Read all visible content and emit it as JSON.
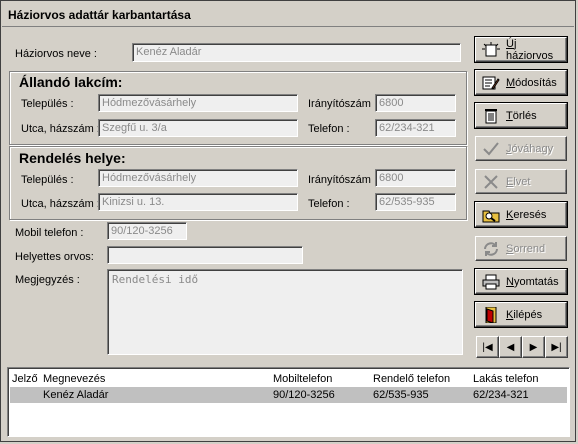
{
  "window": {
    "title": "Háziorvos adattár karbantartása"
  },
  "doctor": {
    "label": "Háziorvos neve :",
    "value": "Kenéz Aladár"
  },
  "permanent_address": {
    "title": "Állandó lakcím:",
    "city_label": "Település :",
    "city_value": "Hódmezővásárhely",
    "zip_label": "Irányítószám :",
    "zip_value": "6800",
    "street_label": "Utca, házszám :",
    "street_value": "Szegfű u. 3/a",
    "phone_label": "Telefon :",
    "phone_value": "62/234-321"
  },
  "office": {
    "title": "Rendelés helye:",
    "city_label": "Település :",
    "city_value": "Hódmezővásárhely",
    "zip_label": "Irányítószám :",
    "zip_value": "6800",
    "street_label": "Utca, házszám :",
    "street_value": "Kinizsi u. 13.",
    "phone_label": "Telefon :",
    "phone_value": "62/535-935"
  },
  "mobile": {
    "label": "Mobil telefon :",
    "value": "90/120-3256"
  },
  "substitute": {
    "label": "Helyettes orvos:",
    "value": ""
  },
  "note": {
    "label": "Megjegyzés :",
    "value": "Rendelési idő"
  },
  "buttons": {
    "new": {
      "prefix": "",
      "hot": "Ú",
      "rest": "j háziorvos",
      "icon": "new-doctor-icon"
    },
    "modify": {
      "prefix": "",
      "hot": "M",
      "rest": "ódosítás",
      "icon": "edit-icon"
    },
    "delete": {
      "prefix": "",
      "hot": "T",
      "rest": "örlés",
      "icon": "trash-icon"
    },
    "approve": {
      "prefix": "",
      "hot": "J",
      "rest": "óváhagy",
      "icon": "checkmark-icon"
    },
    "cancel": {
      "prefix": "",
      "hot": "E",
      "rest": "lvet",
      "icon": "cross-icon"
    },
    "search": {
      "prefix": "",
      "hot": "K",
      "rest": "eresés",
      "icon": "search-folder-icon"
    },
    "sort": {
      "prefix": "",
      "hot": "S",
      "rest": "orrend",
      "icon": "sort-arrows-icon"
    },
    "print": {
      "prefix": "",
      "hot": "N",
      "rest": "yomtatás",
      "icon": "printer-icon"
    },
    "exit": {
      "prefix": "",
      "hot": "K",
      "rest": "ilépés",
      "icon": "exit-door-icon"
    }
  },
  "navigator": {
    "first": "|◀",
    "prev": "◀",
    "next": "▶",
    "last": "▶|"
  },
  "table": {
    "columns": [
      "Jelző",
      "Megnevezés",
      "Mobiltelefon",
      "Rendelő telefon",
      "Lakás telefon"
    ],
    "rows": [
      {
        "flag": "",
        "name": "Kenéz Aladár",
        "mobile": "90/120-3256",
        "office_phone": "62/535-935",
        "home_phone": "62/234-321"
      }
    ]
  }
}
